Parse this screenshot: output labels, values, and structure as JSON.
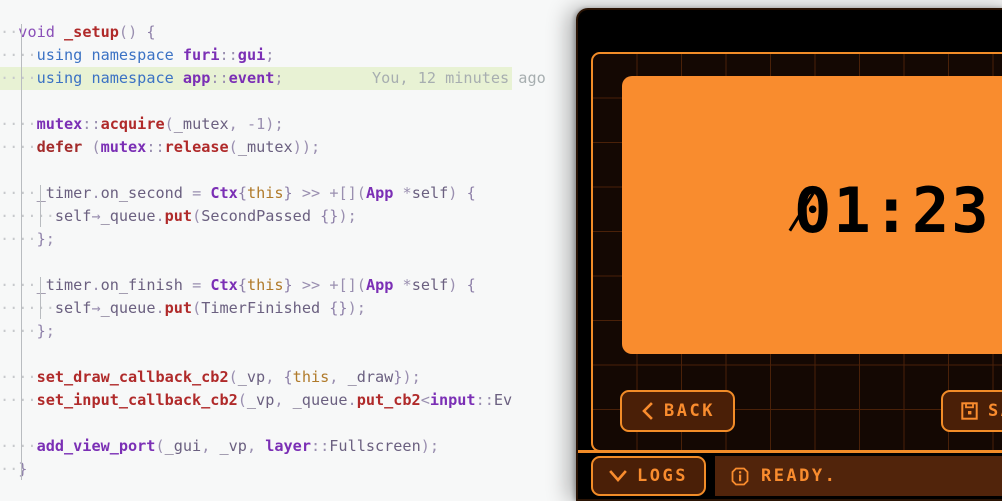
{
  "editor": {
    "blame_annotation": "You, 12 minutes ago",
    "lines": [
      {
        "indent": 1,
        "text": "void _setup() {"
      },
      {
        "indent": 2,
        "text": "using namespace furi::gui;"
      },
      {
        "indent": 2,
        "text": "using namespace app::event;",
        "highlighted": true
      },
      {
        "indent": 0,
        "text": ""
      },
      {
        "indent": 2,
        "text": "mutex::acquire(_mutex, -1);"
      },
      {
        "indent": 2,
        "text": "defer (mutex::release(_mutex));"
      },
      {
        "indent": 0,
        "text": ""
      },
      {
        "indent": 2,
        "text": "_timer.on_second = Ctx{this} >> +[](App *self) {"
      },
      {
        "indent": 3,
        "text": "self→_queue.put(SecondPassed {});"
      },
      {
        "indent": 2,
        "text": "};"
      },
      {
        "indent": 0,
        "text": ""
      },
      {
        "indent": 2,
        "text": "_timer.on_finish = Ctx{this} >> +[](App *self) {"
      },
      {
        "indent": 3,
        "text": "self→_queue.put(TimerFinished {});"
      },
      {
        "indent": 2,
        "text": "};"
      },
      {
        "indent": 0,
        "text": ""
      },
      {
        "indent": 2,
        "text": "set_draw_callback_cb2(_vp, {this, _draw});"
      },
      {
        "indent": 2,
        "text": "set_input_callback_cb2(_vp, _queue.put_cb2<input::Ev"
      },
      {
        "indent": 0,
        "text": ""
      },
      {
        "indent": 2,
        "text": "add_view_port(_gui, _vp, layer::Fullscreen);"
      },
      {
        "indent": 1,
        "text": "}"
      }
    ]
  },
  "device": {
    "screen": {
      "timer_minutes": "01",
      "timer_separator": ":",
      "timer_seconds": "23",
      "timer_display": "01:23"
    },
    "buttons": {
      "back_label": "BACK",
      "back_icon": "chevron-left-icon",
      "save_label": "SAVE",
      "save_icon": "floppy-disk-icon",
      "logs_label": "LOGS",
      "logs_icon": "chevron-down-icon"
    },
    "status": {
      "text": "READY.",
      "icon": "info-icon"
    },
    "colors": {
      "screen_orange": "#f98c2e",
      "accent_orange": "#f28c28",
      "button_fill": "#4a1f07",
      "status_fill": "#51240b",
      "grid_line": "#4a2109",
      "stage_bg": "#140803",
      "frame_black": "#000000"
    }
  }
}
